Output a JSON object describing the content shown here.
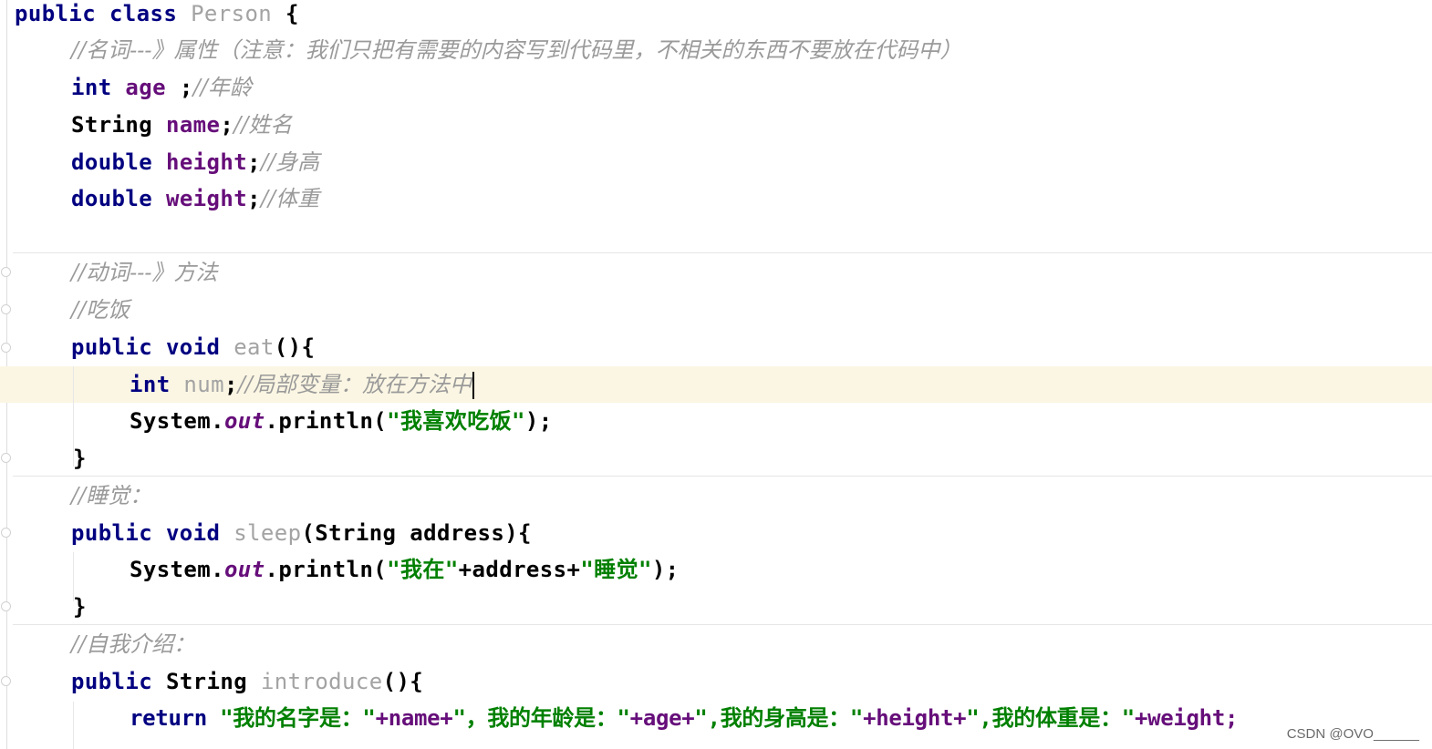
{
  "code": {
    "class_decl": {
      "kw": "public class",
      "name": "Person",
      "brace": "{"
    },
    "comment_properties": "//名词---》属性（注意：我们只把有需要的内容写到代码里，不相关的东西不要放在代码中）",
    "field_age": {
      "type": "int",
      "name": "age",
      "semi": ";",
      "comment": "//年龄"
    },
    "field_name": {
      "type": "String",
      "name": "name",
      "semi": ";",
      "comment": "//姓名"
    },
    "field_height": {
      "type": "double",
      "name": "height",
      "semi": ";",
      "comment": "//身高"
    },
    "field_weight": {
      "type": "double",
      "name": "weight",
      "semi": ";",
      "comment": "//体重"
    },
    "comment_methods": "//动词---》方法",
    "comment_eat": "//吃饭",
    "eat_decl": {
      "kw": "public void",
      "name": "eat",
      "rest": "(){"
    },
    "local_num": {
      "type": "int",
      "name": "num",
      "semi": ";",
      "comment": "//局部变量：放在方法中"
    },
    "eat_print": {
      "prefix": "System.",
      "static": "out",
      "call": ".println(",
      "str": "\"我喜欢吃饭\"",
      "end": ");"
    },
    "close_brace": "}",
    "comment_sleep": "//睡觉：",
    "sleep_decl": {
      "kw": "public void",
      "name": "sleep",
      "rest": "(String address){"
    },
    "sleep_print": {
      "prefix": "System.",
      "static": "out",
      "call": ".println(",
      "str1": "\"我在\"",
      "mid": "+address+",
      "str2": "\"睡觉\"",
      "end": ");"
    },
    "comment_intro": "//自我介绍：",
    "intro_decl": {
      "kw": "public",
      "type": "String",
      "name": "introduce",
      "rest": "(){"
    },
    "intro_return": {
      "kw": "return",
      "s1": "\"我的名字是：\"",
      "v1": "+name+",
      "s2": "\"，我的年龄是：\"",
      "v2": "+age+",
      "s3": "\",我的身高是：\"",
      "v3": "+height+",
      "s4": "\",我的体重是：\"",
      "v4": "+weight;"
    }
  },
  "watermark": "CSDN @OVO______",
  "colors": {
    "keyword": "#000080",
    "field": "#660e7a",
    "string": "#008000",
    "comment": "#9a9a9a",
    "caret_line": "#fbf6e3"
  }
}
